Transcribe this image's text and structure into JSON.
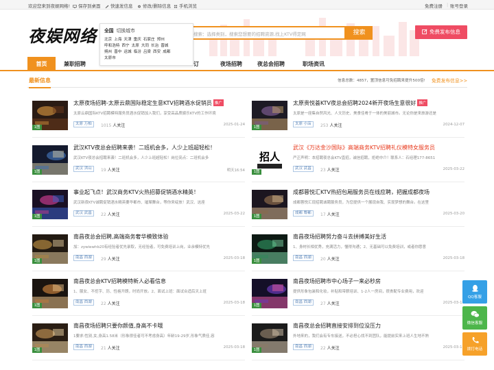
{
  "topbar": {
    "welcome": "欢迎您来到夜娱网络!",
    "save_desktop": "保存到桌面",
    "quick_post": "快速发信息",
    "edit_delete": "修改/删除信息",
    "mobile": "手机浏览",
    "register": "免费注册",
    "login": "账号登录"
  },
  "header": {
    "logo": "夜娱网络",
    "search_placeholder": "搜索：选择类别，搜索您想要的招聘资源,找上KTV得定网",
    "search_button": "搜索",
    "publish_button": "免费发布信息"
  },
  "city_popup": {
    "current": "全国",
    "switch_label": "切换城市",
    "rows": [
      [
        "北京",
        "上海",
        "天津",
        "重庆",
        "石家庄",
        "郑州"
      ],
      [
        "呼和浩特",
        "西宁",
        "太原",
        "大同",
        "长治",
        "晋城"
      ],
      [
        "朔州",
        "晋中",
        "运城",
        "临汾",
        "吕梁",
        "西安",
        "成都"
      ],
      [
        "太原市"
      ]
    ]
  },
  "nav": {
    "items": [
      "首页",
      "兼职招聘",
      "",
      "",
      "订",
      "夜场招聘",
      "夜总会招聘",
      "职场资讯"
    ]
  },
  "section": {
    "title": "最新信息",
    "info": "信息总数：4857，置顶信息可免招聘来提升500倍!",
    "more": "免费发布信息>>"
  },
  "cards": [
    {
      "title": "太原夜场招聘-太原云鼎国际稳定生意KTV招聘酒水促销员",
      "tag": "推广",
      "red": false,
      "desc": "太原云鼎国际KTV招聘模特服务员酒水促销加入我们，享受高品质娱乐KTV的工作环境",
      "chip": "太原 万柏",
      "n": "1015",
      "att": "人关注",
      "date": "2025-01-24",
      "img": 1
    },
    {
      "title": "太原贵悦荟KTV夜总会招聘2024新开夜场生意很好",
      "tag": "推广",
      "red": false,
      "desc": "太原是一座集自然风光、人文历史、美食佳肴于一体的美丽城市。无论你是来旅游还是",
      "chip": "太原 小店",
      "n": "253",
      "att": "人关注",
      "date": "2024-12-07",
      "img": 2
    },
    {
      "title": "武汉KTV夜总会招聘来袭！二班机会多，人少上班超轻松！",
      "tag": "",
      "red": false,
      "desc": "武汉KTV夜总会招聘来袭！二班机会多，人少上班超轻松！岗位亮点：二班机会多",
      "chip": "武汉 洪山",
      "n": "19",
      "att": "人关注",
      "date": "明天16:54",
      "img": 3
    },
    {
      "title": "武汉《万达金沙国际》高端商务KTV招聘礼仪模特女服务员",
      "tag": "",
      "red": true,
      "desc": "严正声明：本招聘夜总会KTV直招，诚信招聘，拒绝中介！联系人：石经理177-8651",
      "chip": "武汉 武昌",
      "n": "23",
      "att": "人关注",
      "date": "2025-03-22",
      "img": 4
    },
    {
      "title": "事业起飞点！武汉商务KTV火热招募促销酒水精英！",
      "tag": "",
      "red": false,
      "desc": "武汉新夜KTV诚聘促销酒水精英要华都市、璀璨舞台，等你来绽放！武汉、这座",
      "chip": "武汉 武昌",
      "n": "22",
      "att": "人关注",
      "date": "2025-03-22",
      "img": 5
    },
    {
      "title": "成都蓉悦汇KTV热招包厢服务员在线应聘，把握成都夜场",
      "tag": "",
      "red": false,
      "desc": "成都蓉悦汇现招聘诚聘服务员，为您提供一个展现自我、实现梦想的舞台。在这里",
      "chip": "成都 郫都",
      "n": "17",
      "att": "人关注",
      "date": "2025-03-20",
      "img": 6
    },
    {
      "title": "南昌夜总会招聘,高端商务奢华模致体验",
      "tag": "",
      "red": false,
      "desc": "加：zywiewhb20有经验者优先录取，无经验者，可免费培训上岗，业余模特优先",
      "chip": "南昌 西湖",
      "n": "29",
      "att": "人关注",
      "date": "2025-03-18",
      "img": 7
    },
    {
      "title": "南昌夜场招聘努力奋斗去拼搏美好生活",
      "tag": "",
      "red": false,
      "desc": "1、身材长相优秀，充满活力，懂得沟通；2、无基础可以免费培训，或者你愿意",
      "chip": "南昌 西湖",
      "n": "20",
      "att": "人关注",
      "date": "2025-03-18",
      "img": 8
    },
    {
      "title": "南昌夜总会KTV招聘模特新人必看信息",
      "tag": "",
      "red": false,
      "desc": "1、服女、不挖字、历、性格开朗，时尚开放。2、面试上班：面试合适后天上班",
      "chip": "南昌 西湖",
      "n": "22",
      "att": "人关注",
      "date": "2025-03-18",
      "img": 9
    },
    {
      "title": "南昌夜场招聘市中心场子一来必秒房",
      "tag": "",
      "red": false,
      "desc": "提供形象包装和化妆，补贴和带薪培训、1-2人一房间，很贵配专业费用，欢迎",
      "chip": "南昌 西湖",
      "n": "27",
      "att": "人关注",
      "date": "2025-03-18",
      "img": 10
    },
    {
      "title": "南昌夜场招聘只要你颜值,身高不卡哦",
      "tag": "",
      "red": false,
      "desc": "1要求:性别,女,身高1.58米（形象很佳者可不考虑身高）年龄19-29岁,形象气质佳,容",
      "chip": "南昌 西湖",
      "n": "21",
      "att": "人关注",
      "date": "2025-03-18",
      "img": 11
    },
    {
      "title": "南昌夜总会招聘直接安排到位没压力",
      "tag": "",
      "red": false,
      "desc": "外地来的，我们会有专车接送，不必担心找不到团队，能提前实来上班人生地不熟",
      "chip": "南昌 西湖",
      "n": "22",
      "att": "人关注",
      "date": "2025-03-18",
      "img": 12
    }
  ],
  "float_buttons": {
    "qq": "QQ客服",
    "wechat": "微信客服",
    "tel": "拨打电话"
  },
  "colors": {
    "accent": "#f0911e",
    "publish": "#ef4c63",
    "tag": "#ef4c63",
    "red_title": "#e8381b",
    "chip": "#5d86b8",
    "thumb_badge": "#3a8f3e"
  },
  "thumb_badge": "1图"
}
